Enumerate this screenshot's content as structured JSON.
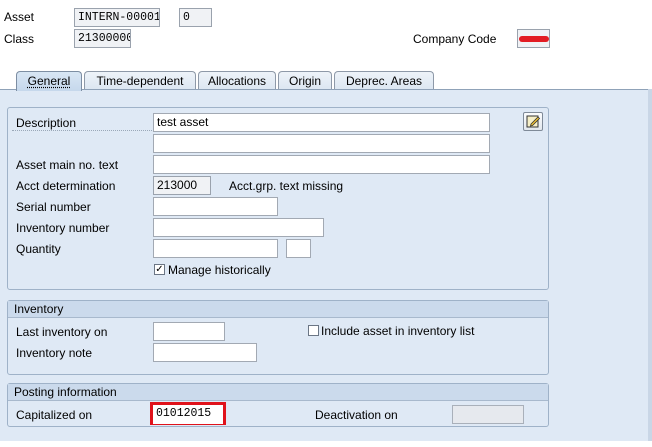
{
  "header": {
    "asset_label": "Asset",
    "asset_value": "INTERN-00001",
    "asset_sub_value": "0",
    "class_label": "Class",
    "class_value": "21300000",
    "company_code_label": "Company Code",
    "company_code_value": ""
  },
  "tabs": [
    {
      "label": "General",
      "active": true
    },
    {
      "label": "Time-dependent",
      "active": false
    },
    {
      "label": "Allocations",
      "active": false
    },
    {
      "label": "Origin",
      "active": false
    },
    {
      "label": "Deprec. Areas",
      "active": false
    }
  ],
  "general": {
    "description_label": "Description",
    "description_value": "test asset",
    "description2_value": "",
    "asset_main_no_text_label": "Asset main no. text",
    "asset_main_no_text_value": "",
    "acct_determination_label": "Acct determination",
    "acct_determination_value": "213000",
    "acct_grp_text": "Acct.grp. text missing",
    "serial_number_label": "Serial number",
    "serial_number_value": "",
    "inventory_number_label": "Inventory number",
    "inventory_number_value": "",
    "quantity_label": "Quantity",
    "quantity_value": "",
    "quantity_unit_value": "",
    "manage_historically_label": "Manage historically",
    "manage_historically_checked": true,
    "edit_icon": "edit-note-icon"
  },
  "inventory": {
    "title": "Inventory",
    "last_inventory_label": "Last inventory on",
    "last_inventory_value": "",
    "include_label": "Include asset in inventory list",
    "include_checked": false,
    "note_label": "Inventory note",
    "note_value": ""
  },
  "posting": {
    "title": "Posting information",
    "capitalized_label": "Capitalized on",
    "capitalized_value": "01012015",
    "deactivation_label": "Deactivation on",
    "deactivation_value": ""
  },
  "colors": {
    "highlight_border": "#e0121b",
    "company_code_redaction": "#e21c23",
    "panel_bg": "#dfe9f5"
  }
}
